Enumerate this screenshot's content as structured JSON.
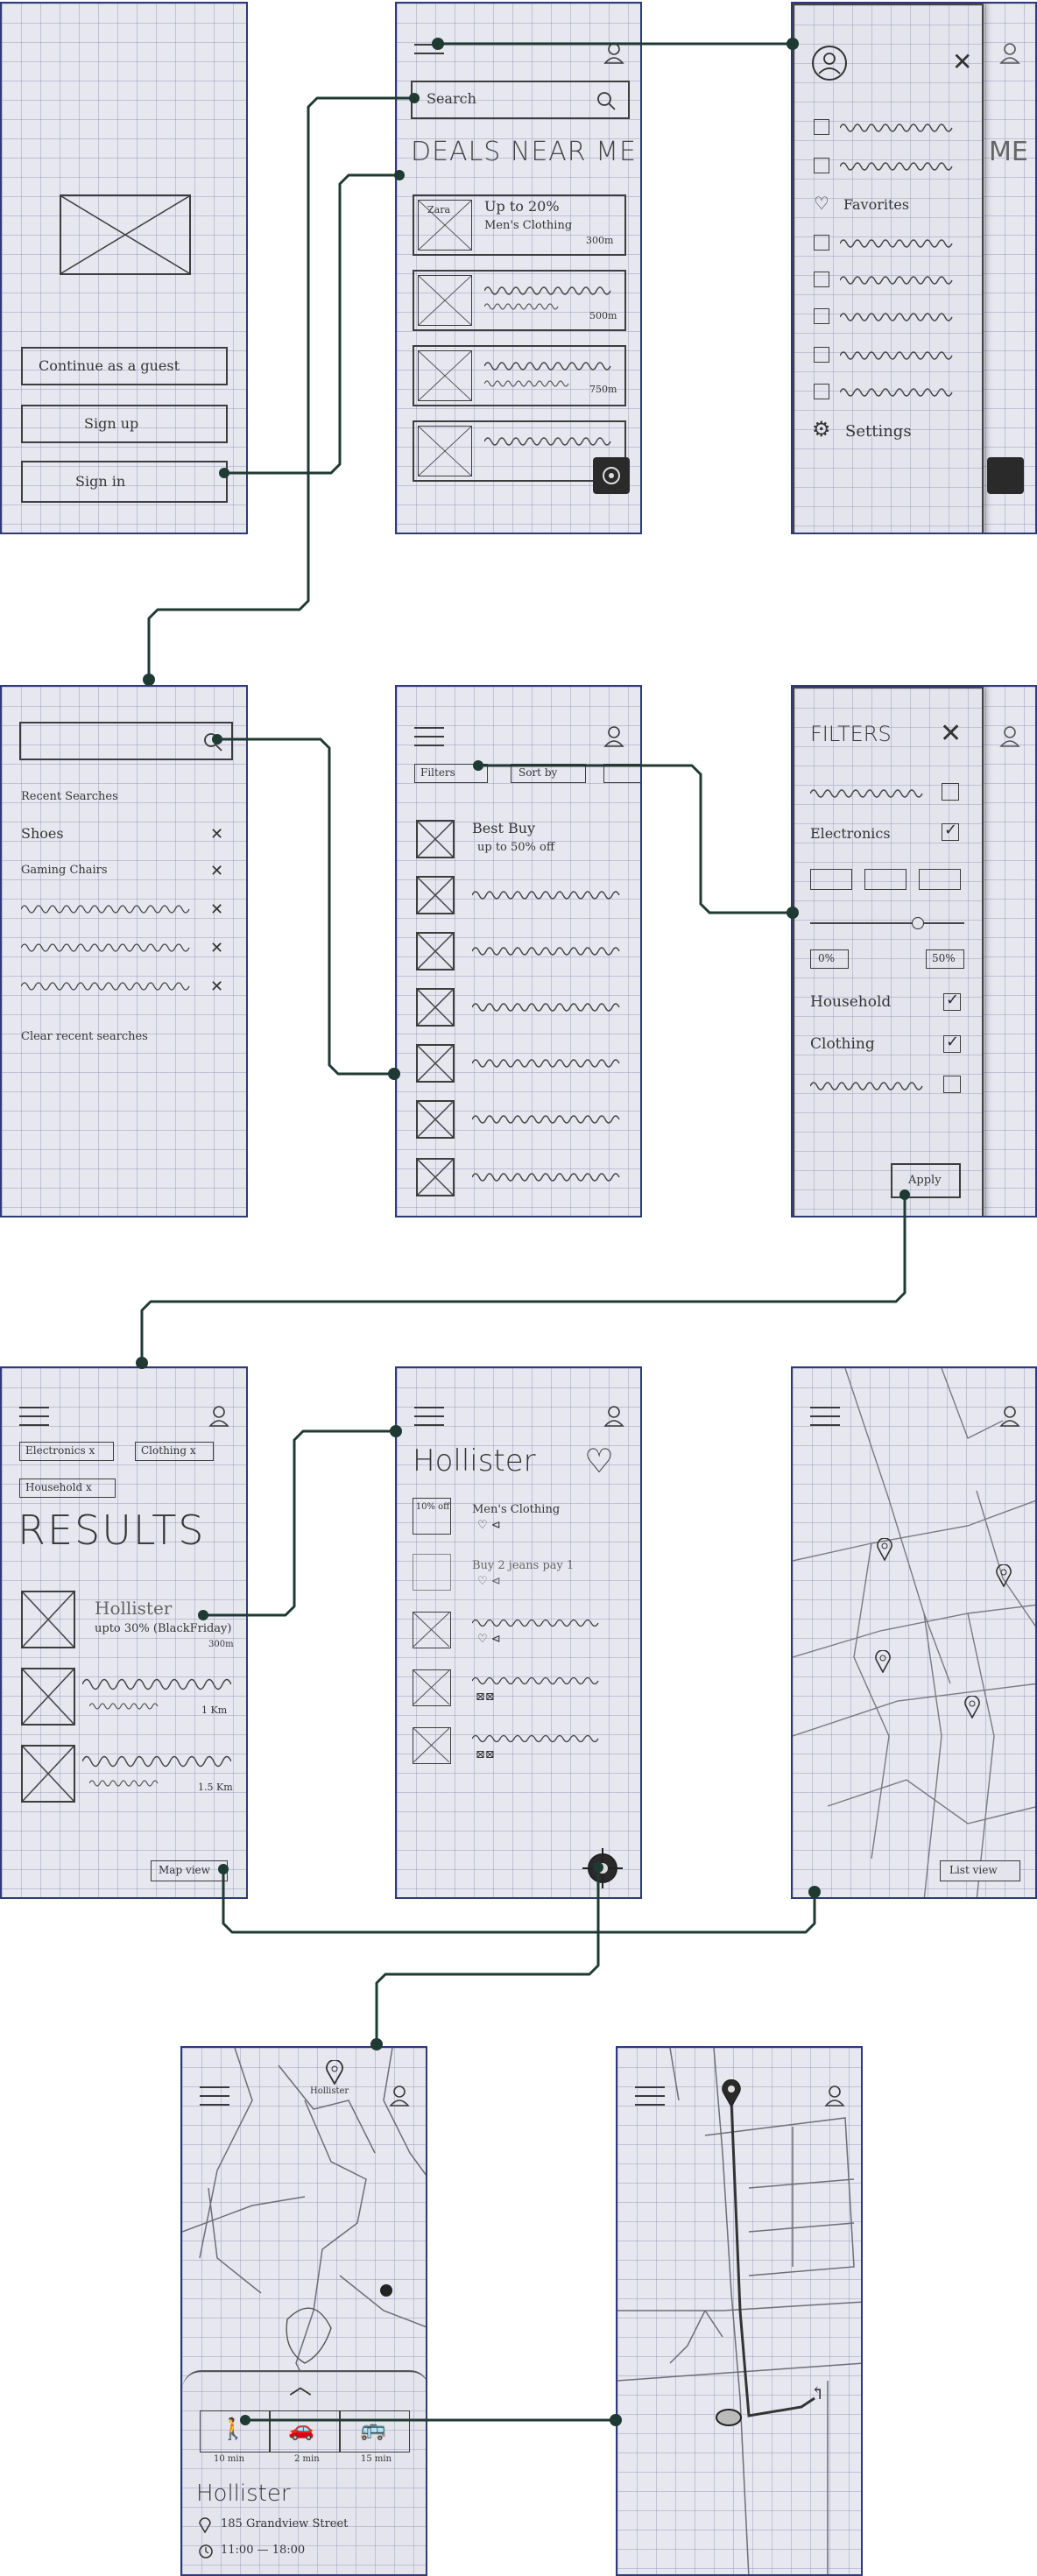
{
  "start": {
    "continue_guest": "Continue as a guest",
    "sign_up": "Sign up",
    "sign_in": "Sign in"
  },
  "home": {
    "search_placeholder": "Search",
    "title": "DEALS NEAR ME",
    "deal1_store": "Zara",
    "deal1_line1": "Up to 20%",
    "deal1_line2": "Men's Clothing",
    "deal1_dist": "300m",
    "deal2_dist": "500m",
    "deal3_dist": "750m"
  },
  "menu": {
    "favorites": "Favorites",
    "settings": "Settings"
  },
  "search": {
    "recent_heading": "Recent Searches",
    "item1": "Shoes",
    "item2": "Gaming Chairs",
    "clear": "Clear recent searches"
  },
  "list": {
    "filters_chip": "Filters",
    "sort_chip": "Sort by",
    "first_store": "Best Buy",
    "first_offer": "up to 50% off"
  },
  "filters": {
    "title": "FILTERS",
    "electronics": "Electronics",
    "min": "0%",
    "max": "50%",
    "household": "Household",
    "clothing": "Clothing",
    "apply": "Apply"
  },
  "results": {
    "chip1": "Electronics x",
    "chip2": "Clothing x",
    "chip3": "Household x",
    "title": "RESULTS",
    "item1_store": "Hollister",
    "item1_offer": "upto 30% (BlackFriday)",
    "item1_dist": "300m",
    "item2_dist": "1 Km",
    "item3_dist": "1.5 Km",
    "map_view": "Map view"
  },
  "store": {
    "name": "Hollister",
    "badge1": "10% off",
    "line1": "Men's Clothing",
    "line2": "Buy 2 jeans pay 1"
  },
  "map": {
    "list_view": "List view"
  },
  "route": {
    "pin_label": "Hollister",
    "walk_time": "10 min",
    "drive_time": "2 min",
    "bus_time": "15 min",
    "store_name": "Hollister",
    "address": "185 Grandview Street",
    "hours": "11:00 — 18:00"
  }
}
